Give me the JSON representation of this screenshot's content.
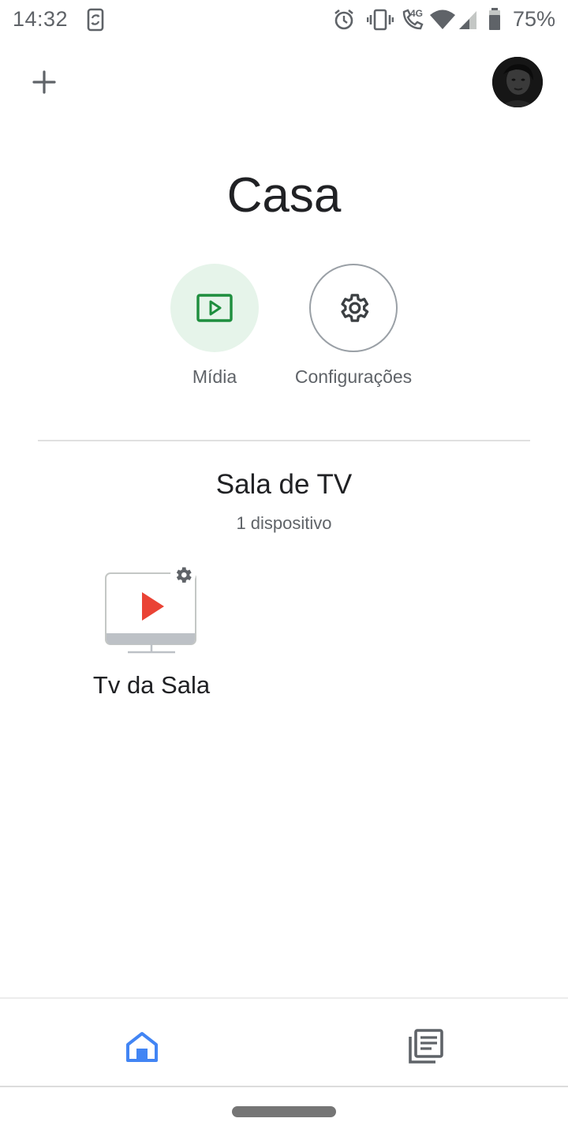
{
  "status_bar": {
    "time": "14:32",
    "battery_percent": "75%",
    "network_label": "4G",
    "icons": [
      "sync-phone-icon",
      "alarm-icon",
      "vibrate-icon",
      "wifi-calling-icon",
      "wifi-icon",
      "signal-icon",
      "battery-icon"
    ]
  },
  "header": {
    "add_icon": "plus-icon",
    "avatar": "account-avatar"
  },
  "home": {
    "title": "Casa"
  },
  "actions": [
    {
      "label": "Mídia",
      "icon": "media-play-icon"
    },
    {
      "label": "Configurações",
      "icon": "gear-icon"
    }
  ],
  "room": {
    "title": "Sala de TV",
    "subtitle": "1 dispositivo",
    "devices": [
      {
        "label": "Tv da Sala",
        "icon": "tv-play-icon",
        "badge_icon": "gear-icon"
      }
    ]
  },
  "bottom_nav": {
    "items": [
      {
        "icon": "home-icon",
        "active": true
      },
      {
        "icon": "feed-icon",
        "active": false
      }
    ]
  },
  "colors": {
    "accent_blue": "#4285f4",
    "media_green": "#1e8e3e",
    "media_chip_bg": "#e6f4ea",
    "play_red": "#ea4335",
    "text_primary": "#202124",
    "text_secondary": "#5f6368"
  }
}
